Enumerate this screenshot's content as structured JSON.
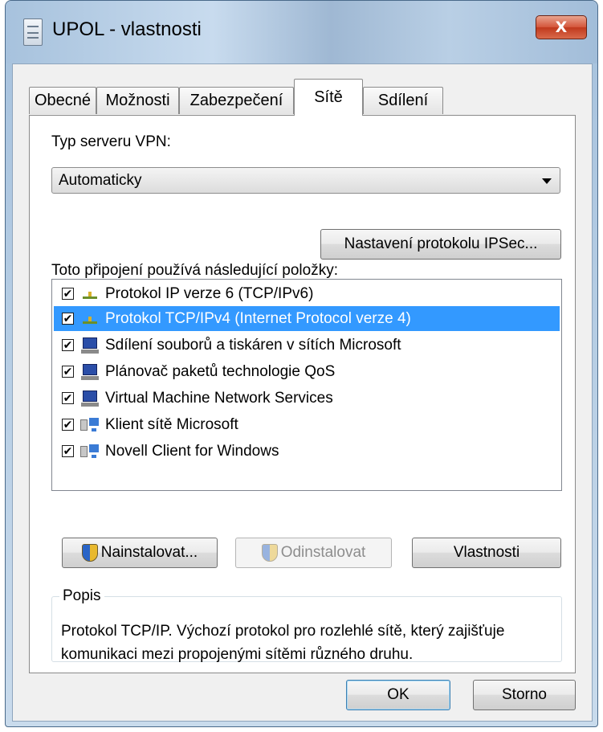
{
  "window": {
    "title": "UPOL - vlastnosti",
    "close_glyph": "X"
  },
  "tabs": [
    {
      "label": "Obecné",
      "active": false
    },
    {
      "label": "Možnosti",
      "active": false
    },
    {
      "label": "Zabezpečení",
      "active": false
    },
    {
      "label": "Sítě",
      "active": true
    },
    {
      "label": "Sdílení",
      "active": false
    }
  ],
  "vpn": {
    "label": "Typ serveru VPN:",
    "selected": "Automaticky",
    "ipsec_button": "Nastavení protokolu IPSec..."
  },
  "items": {
    "label": "Toto připojení používá následující položky:",
    "list": [
      {
        "label": "Protokol IP verze 6 (TCP/IPv6)",
        "checked": true,
        "icon": "network-protocol-icon",
        "selected": false
      },
      {
        "label": "Protokol TCP/IPv4 (Internet Protocol verze 4)",
        "checked": true,
        "icon": "network-protocol-icon",
        "selected": true
      },
      {
        "label": "Sdílení souborů a tiskáren v sítích Microsoft",
        "checked": true,
        "icon": "computer-icon",
        "selected": false
      },
      {
        "label": "Plánovač paketů technologie QoS",
        "checked": true,
        "icon": "computer-icon",
        "selected": false
      },
      {
        "label": "Virtual Machine Network Services",
        "checked": true,
        "icon": "computer-icon",
        "selected": false
      },
      {
        "label": "Klient sítě Microsoft",
        "checked": true,
        "icon": "network-client-icon",
        "selected": false
      },
      {
        "label": "Novell Client for Windows",
        "checked": true,
        "icon": "network-client-icon",
        "selected": false
      }
    ]
  },
  "buttons": {
    "install": "Nainstalovat...",
    "uninstall": "Odinstalovat",
    "properties": "Vlastnosti",
    "ok": "OK",
    "cancel": "Storno"
  },
  "description": {
    "label": "Popis",
    "text": "Protokol TCP/IP. Výchozí protokol pro rozlehlé sítě, který zajišťuje komunikaci mezi propojenými sítěmi různého druhu."
  },
  "colors": {
    "selection": "#3399ff",
    "close_button": "#c8452a",
    "title_bar": "#b9cfe5"
  }
}
